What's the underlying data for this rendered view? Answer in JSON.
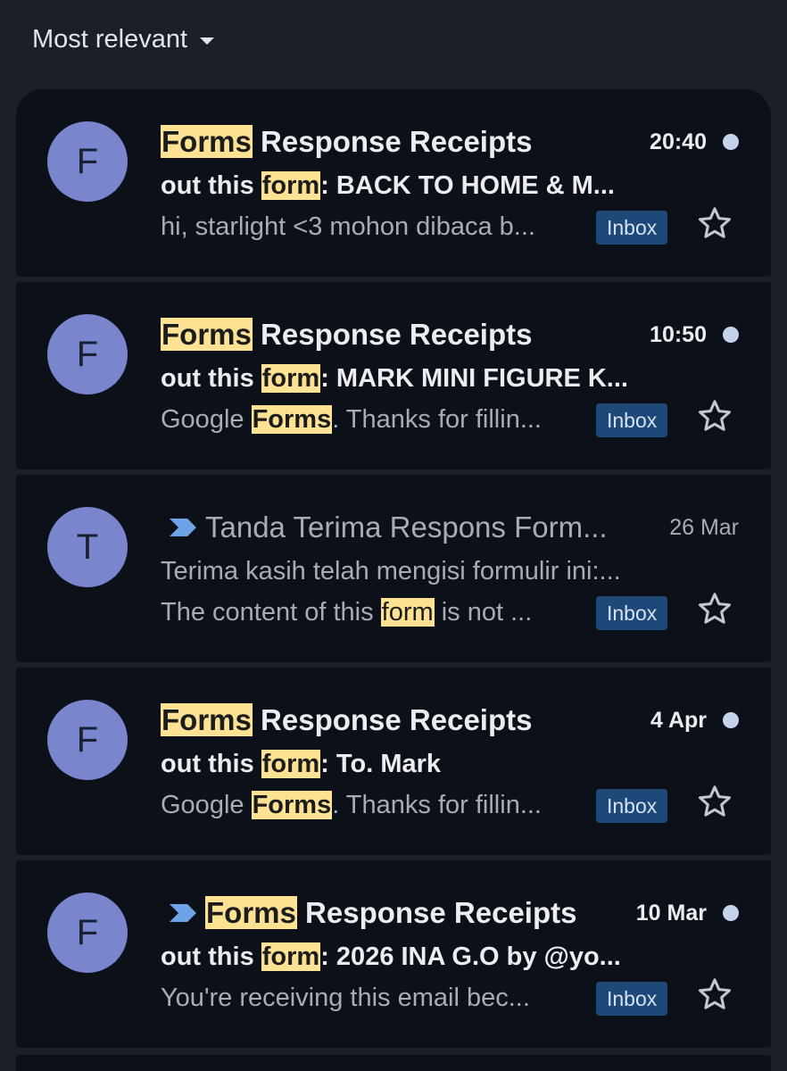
{
  "sort": {
    "label": "Most relevant"
  },
  "colors": {
    "background": "#1b1f27",
    "card": "#0c1019",
    "avatar": "#7985cc",
    "highlight": "#fde293",
    "label_bg": "#1d4877",
    "unread_dot": "#c6d2ec"
  },
  "emails": [
    {
      "avatar": "F",
      "sender": {
        "pre": "",
        "hl": "Forms",
        "post": " Response Receipts"
      },
      "date": "20:40",
      "subject": {
        "pre": "out this ",
        "hl": "form",
        "post": ": BACK TO HOME & M..."
      },
      "snippet": {
        "pre": "hi, starlight <3 mohon dibaca b...",
        "hl": "",
        "post": ""
      },
      "label": "Inbox"
    },
    {
      "avatar": "F",
      "sender": {
        "pre": "",
        "hl": "Forms",
        "post": " Response Receipts"
      },
      "date": "10:50",
      "subject": {
        "pre": "out this ",
        "hl": "form",
        "post": ": MARK MINI FIGURE K..."
      },
      "snippet": {
        "pre": "Google ",
        "hl": "Forms",
        "post": ". Thanks for fillin..."
      },
      "label": "Inbox"
    },
    {
      "avatar": "T",
      "sender": {
        "pre": "Tanda Terima Respons Form...",
        "hl": "",
        "post": ""
      },
      "date": "26 Mar",
      "subject": {
        "pre": "Terima kasih telah mengisi formulir ini:...",
        "hl": "",
        "post": ""
      },
      "snippet": {
        "pre": "The content of this ",
        "hl": "form",
        "post": " is not ..."
      },
      "label": "Inbox"
    },
    {
      "avatar": "F",
      "sender": {
        "pre": "",
        "hl": "Forms",
        "post": " Response Receipts"
      },
      "date": "4 Apr",
      "subject": {
        "pre": "out this ",
        "hl": "form",
        "post": ": To. Mark"
      },
      "snippet": {
        "pre": "Google ",
        "hl": "Forms",
        "post": ". Thanks for fillin..."
      },
      "label": "Inbox"
    },
    {
      "avatar": "F",
      "sender": {
        "pre": "",
        "hl": "Forms",
        "post": " Response Receipts"
      },
      "date": "10 Mar",
      "subject": {
        "pre": "out this ",
        "hl": "form",
        "post": ": 2026 INA G.O by @yo..."
      },
      "snippet": {
        "pre": "You're receiving this email bec...",
        "hl": "",
        "post": ""
      },
      "label": "Inbox"
    }
  ]
}
